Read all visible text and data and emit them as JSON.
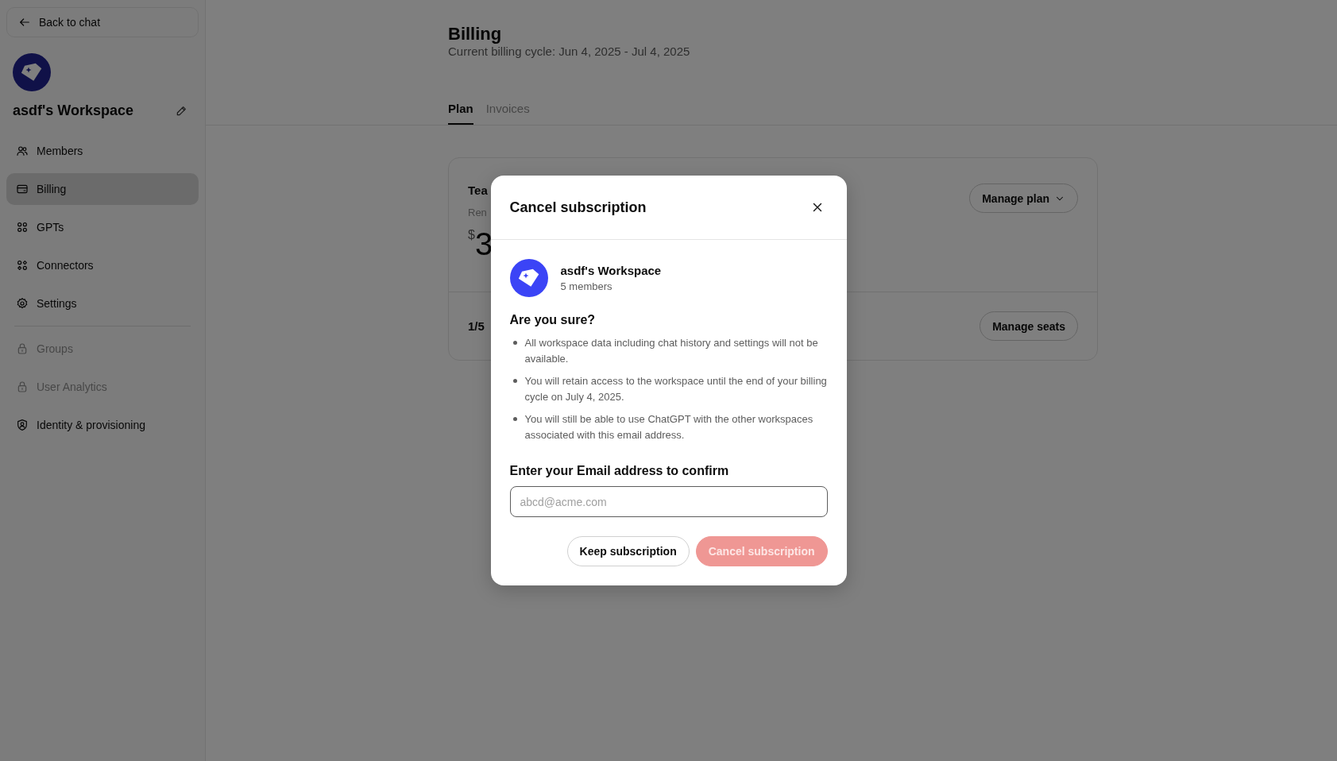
{
  "sidebar": {
    "back_link": "Back to chat",
    "workspace_name": "asdf's Workspace",
    "items": [
      {
        "label": "Members",
        "kind": "members",
        "selected": false,
        "disabled": false
      },
      {
        "label": "Billing",
        "kind": "billing",
        "selected": true,
        "disabled": false
      },
      {
        "label": "GPTs",
        "kind": "gpts",
        "selected": false,
        "disabled": false
      },
      {
        "label": "Connectors",
        "kind": "connectors",
        "selected": false,
        "disabled": false
      },
      {
        "label": "Settings",
        "kind": "settings",
        "selected": false,
        "disabled": false
      },
      {
        "label": "Groups",
        "kind": "locked",
        "selected": false,
        "disabled": true
      },
      {
        "label": "User Analytics",
        "kind": "locked",
        "selected": false,
        "disabled": true
      },
      {
        "label": "Identity & provisioning",
        "kind": "identity",
        "selected": false,
        "disabled": false
      }
    ]
  },
  "page": {
    "title": "Billing",
    "subtitle": "Current billing cycle: Jun 4, 2025 - Jul 4, 2025",
    "tabs": [
      {
        "label": "Plan",
        "selected": true
      },
      {
        "label": "Invoices",
        "selected": false
      }
    ],
    "plan_card": {
      "plan_name": "Tea",
      "renewal": "Ren",
      "currency": "$",
      "price": "3",
      "manage_plan": "Manage plan",
      "seats": "1/5",
      "manage_seats": "Manage seats"
    }
  },
  "dialog": {
    "title": "Cancel subscription",
    "workspace_name": "asdf's Workspace",
    "members": "5 members",
    "question": "Are you sure?",
    "points": [
      "All workspace data including chat history and settings will not be available.",
      "You will retain access to the workspace until the end of your billing cycle on July 4, 2025.",
      "You will still be able to use ChatGPT with the other workspaces associated with this email address."
    ],
    "email_label": "Enter your Email address to confirm",
    "email_placeholder": "abcd@acme.com",
    "buttons": [
      {
        "label": "Keep subscription",
        "kind": "secondary",
        "disabled": false
      },
      {
        "label": "Cancel subscription",
        "kind": "danger",
        "disabled": true
      }
    ]
  }
}
